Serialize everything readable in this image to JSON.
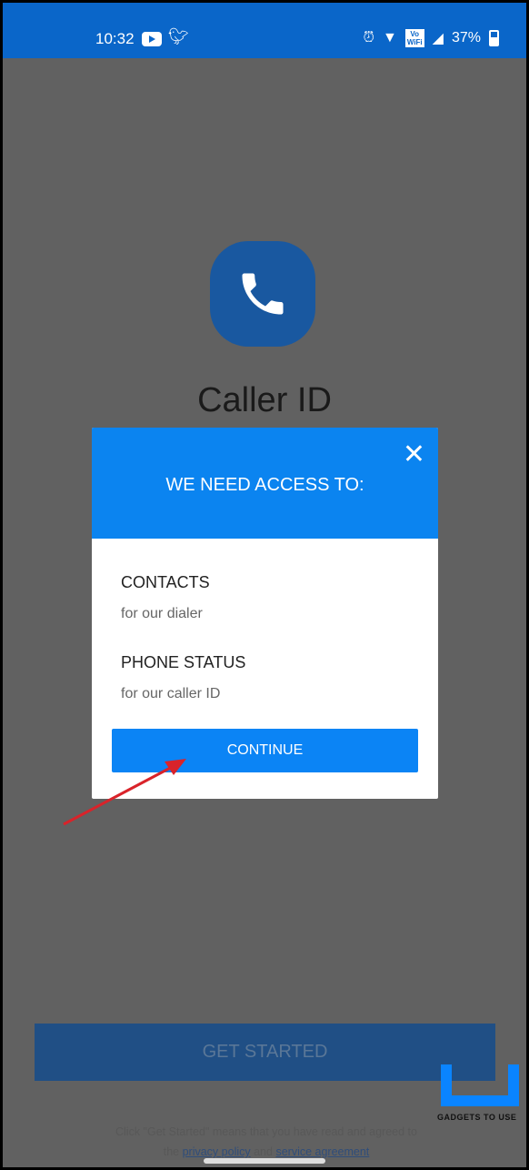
{
  "status_bar": {
    "time": "10:32",
    "battery": "37%",
    "vowifi": "Vo\nWiFi",
    "icons": [
      "youtube-icon",
      "twitter-icon",
      "alarm-icon",
      "wifi-icon",
      "vowifi-icon",
      "signal-icon",
      "battery-icon"
    ]
  },
  "app": {
    "title": "Caller ID",
    "logo_icon": "phone-icon"
  },
  "dialog": {
    "title": "WE NEED ACCESS TO:",
    "close_icon": "close-icon",
    "permissions": [
      {
        "name": "CONTACTS",
        "reason": "for our dialer"
      },
      {
        "name": "PHONE STATUS",
        "reason": "for our caller ID"
      }
    ],
    "continue_label": "CONTINUE"
  },
  "get_started_label": "GET STARTED",
  "legal": {
    "text": "Click \"Get Started\" means that you have read and agreed to",
    "prefix": "the",
    "privacy": "privacy policy",
    "and": "and",
    "service": "service agreement"
  },
  "watermark": {
    "text": "GADGETS TO USE"
  },
  "colors": {
    "status_bar": "#0a66c9",
    "dialog_header": "#0b84f0",
    "button": "#0b84f5",
    "overlay": "#616161",
    "arrow": "#d9232a"
  }
}
